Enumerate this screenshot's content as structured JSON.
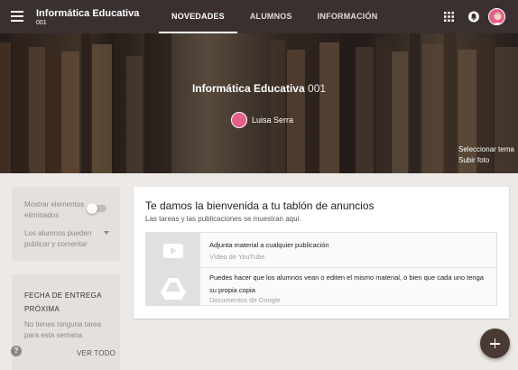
{
  "header": {
    "class_name": "Informática Educativa",
    "section": "001",
    "tabs": [
      {
        "label": "NOVEDADES",
        "active": true
      },
      {
        "label": "ALUMNOS",
        "active": false
      },
      {
        "label": "INFORMACIÓN",
        "active": false
      }
    ],
    "icons": [
      "menu-icon",
      "apps-icon",
      "bell-icon",
      "avatar"
    ]
  },
  "banner": {
    "class_name": "Informática Educativa",
    "section": "001",
    "teacher": "Luisa Serra",
    "select_theme": "Seleccionar tema",
    "upload_photo": "Subir foto"
  },
  "sidebar": {
    "show_deleted": "Mostrar elementos eliminados",
    "permissions": "Los alumnos pueden publicar y comentar",
    "due_title": "FECHA DE ENTREGA PRÓXIMA",
    "due_empty": "No tienes ninguna tarea para esta semana",
    "view_all": "VER TODO"
  },
  "welcome": {
    "title": "Te damos la bienvenida a tu tablón de anuncios",
    "subtitle": "Las tareas y las publicaciones se muestran aquí.",
    "items": [
      {
        "title": "Adjunta material a cualquier publicación",
        "source": "Vídeo de YouTube",
        "icon": "youtube-icon"
      },
      {
        "title": "Puedes hacer que los alumnos vean o editen el mismo material, o bien que cada uno tenga su propia copia",
        "source": "Documentos de Google",
        "icon": "drive-icon"
      }
    ]
  },
  "colors": {
    "topbar": "#3a3030",
    "accent_avatar": "#e45f89",
    "fab": "#4b3a34",
    "background": "#ece9e6"
  }
}
